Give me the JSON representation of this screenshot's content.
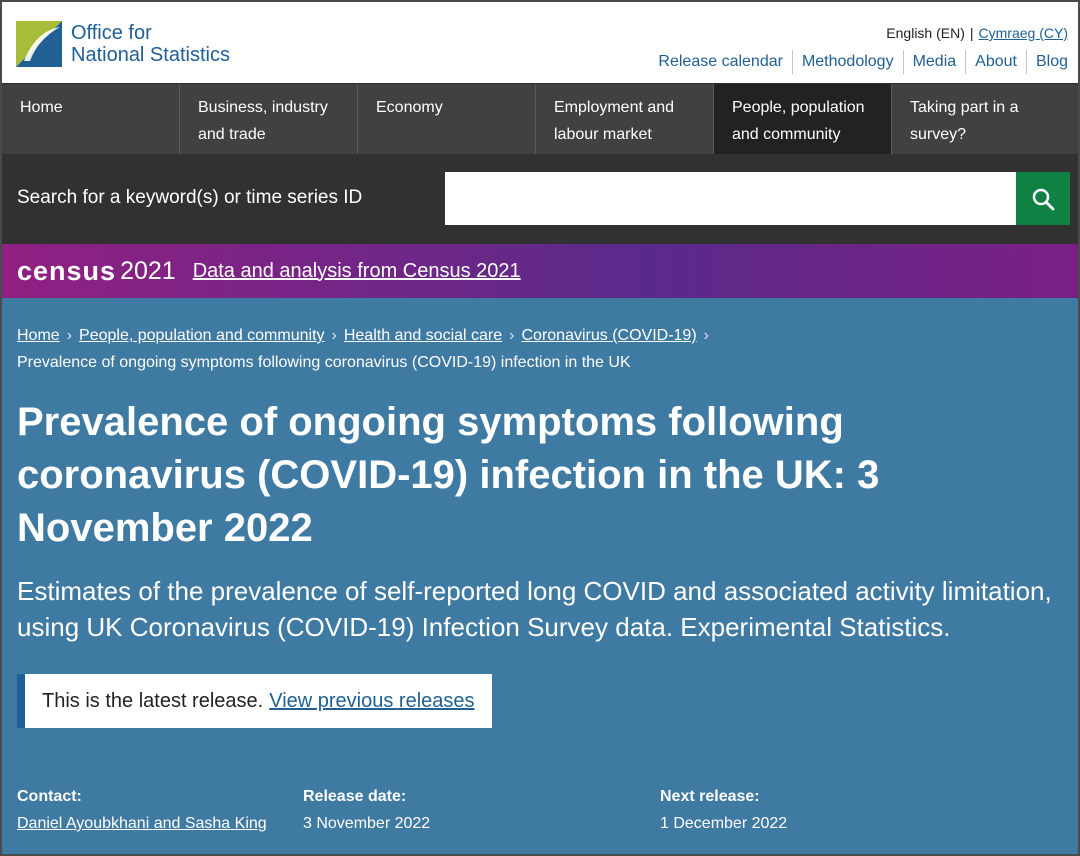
{
  "header": {
    "logo_line1": "Office for",
    "logo_line2": "National Statistics",
    "lang_en": "English (EN)",
    "lang_sep": "|",
    "lang_cy": "Cymraeg (CY)",
    "links": [
      "Release calendar",
      "Methodology",
      "Media",
      "About",
      "Blog"
    ]
  },
  "nav": {
    "items": [
      "Home",
      "Business, industry and trade",
      "Economy",
      "Employment and labour market",
      "People, population and community",
      "Taking part in a survey?"
    ]
  },
  "search": {
    "label": "Search for a keyword(s) or time series ID",
    "value": "",
    "icon": "search-icon"
  },
  "census": {
    "logo": "census",
    "year": "2021",
    "link": "Data and analysis from Census 2021"
  },
  "breadcrumb": {
    "items": [
      "Home",
      "People, population and community",
      "Health and social care",
      "Coronavirus (COVID-19)"
    ],
    "current": "Prevalence of ongoing symptoms following coronavirus (COVID-19) infection in the UK"
  },
  "page": {
    "title": "Prevalence of ongoing symptoms following coronavirus (COVID-19) infection in the UK: 3 November 2022",
    "subtitle": "Estimates of the prevalence of self-reported long COVID and associated activity limitation, using UK Coronavirus (COVID-19) Infection Survey data. Experimental Statistics.",
    "release_text": "This is the latest release.",
    "release_link": "View previous releases"
  },
  "meta": {
    "contact_label": "Contact:",
    "contact_value": "Daniel Ayoubkhani and Sasha King",
    "release_label": "Release date:",
    "release_value": "3 November 2022",
    "next_label": "Next release:",
    "next_value": "1 December 2022"
  },
  "colors": {
    "brand_blue": "#206095",
    "hero": "#3f7aa2",
    "nav": "#414042",
    "search_btn": "#0f8243",
    "census_purple": "#902082"
  }
}
